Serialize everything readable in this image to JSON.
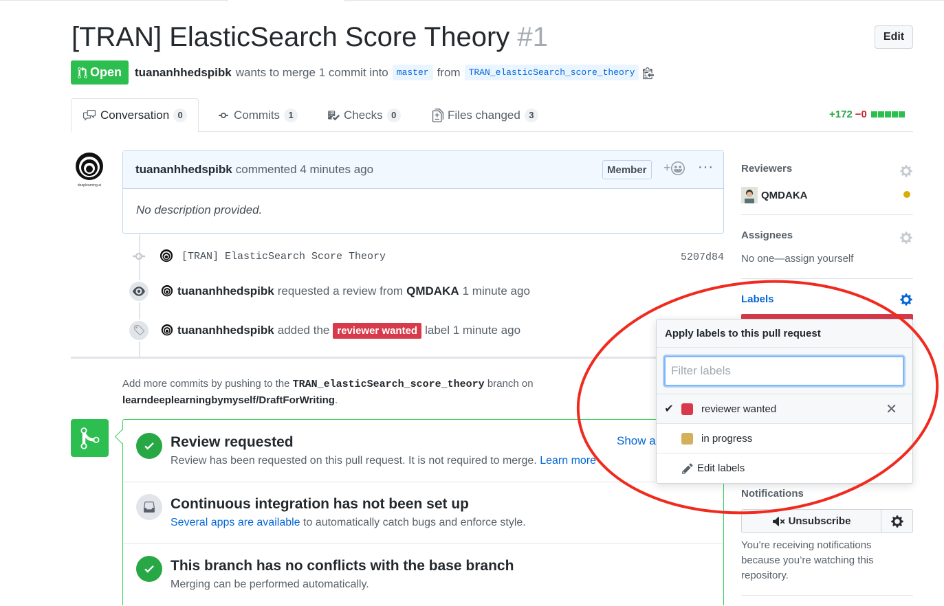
{
  "pr": {
    "title": "[TRAN] ElasticSearch Score Theory",
    "number": "#1",
    "state": "Open",
    "author": "tuananhhedspibk",
    "merge_text": "wants to merge 1 commit into",
    "base_branch": "master",
    "from_text": "from",
    "head_branch": "TRAN_elasticSearch_score_theory",
    "edit_label": "Edit"
  },
  "tabs": [
    {
      "label": "Conversation",
      "count": "0"
    },
    {
      "label": "Commits",
      "count": "1"
    },
    {
      "label": "Checks",
      "count": "0"
    },
    {
      "label": "Files changed",
      "count": "3"
    }
  ],
  "diffstat": {
    "additions": "+172",
    "deletions": "−0"
  },
  "comment": {
    "author": "tuananhhedspibk",
    "action": "commented 4 minutes ago",
    "badge": "Member",
    "body": "No description provided.",
    "avatar_caption": "deeplearning.ai"
  },
  "timeline": {
    "commit_message": "[TRAN] ElasticSearch Score Theory",
    "commit_sha": "5207d84",
    "review_actor": "tuananhhedspibk",
    "review_text": "requested a review from",
    "review_target": "QMDAKA",
    "review_time": "1 minute ago",
    "label_actor": "tuananhhedspibk",
    "label_text": "added the",
    "label_name": "reviewer wanted",
    "label_suffix": "label 1 minute ago"
  },
  "push_note": {
    "prefix": "Add more commits by pushing to the",
    "branch": "TRAN_elasticSearch_score_theory",
    "middle": "branch on",
    "repo": "learndeeplearningbymyself/DraftForWriting",
    "suffix": "."
  },
  "merge_status": {
    "review_title": "Review requested",
    "review_desc": "Review has been requested on this pull request. It is not required to merge.",
    "review_link": "Learn more",
    "show_all": "Show all",
    "ci_title": "Continuous integration has not been set up",
    "ci_link": "Several apps are available",
    "ci_desc": "to automatically catch bugs and enforce style.",
    "conflict_title": "This branch has no conflicts with the base branch",
    "conflict_desc": "Merging can be performed automatically."
  },
  "sidebar": {
    "reviewers_heading": "Reviewers",
    "reviewer_name": "QMDAKA",
    "assignees_heading": "Assignees",
    "assignees_text": "No one—assign yourself",
    "labels_heading": "Labels",
    "notifications_heading": "Notifications",
    "unsubscribe_label": "Unsubscribe",
    "notifications_text": "You’re receiving notifications because you’re watching this repository."
  },
  "label_popover": {
    "header": "Apply labels to this pull request",
    "filter_placeholder": "Filter labels",
    "items": [
      {
        "name": "reviewer wanted",
        "color": "#d73a4a",
        "selected": true
      },
      {
        "name": "in progress",
        "color": "#d4b05a",
        "selected": false
      }
    ],
    "edit_label": "Edit labels"
  },
  "colors": {
    "open_green": "#2cbe4e",
    "link_blue": "#0366d6",
    "label_red": "#d73a4a",
    "annotation_red": "#f02a1e"
  }
}
